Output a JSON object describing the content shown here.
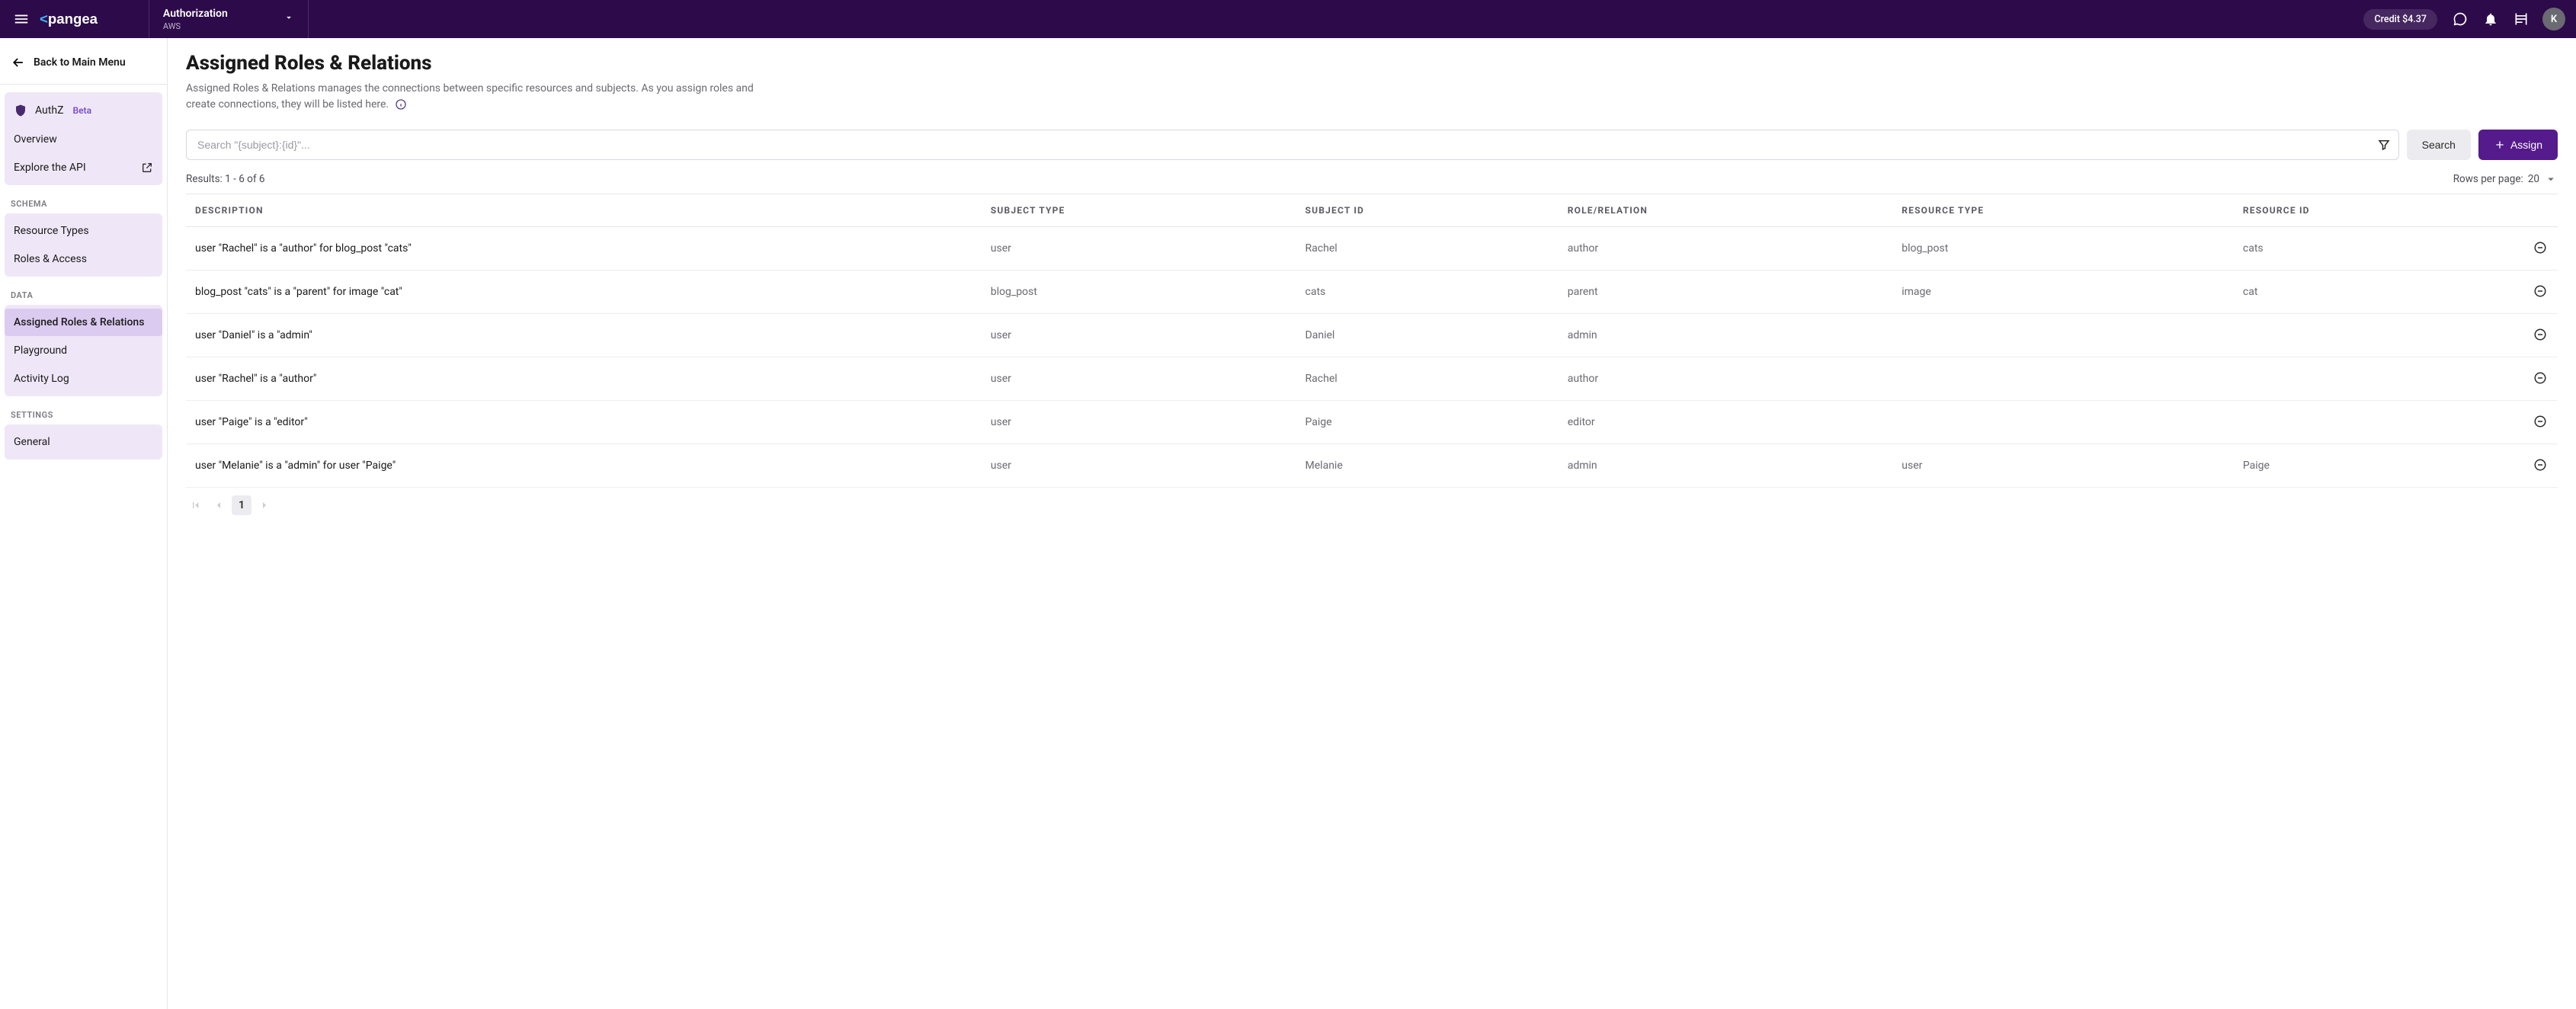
{
  "header": {
    "project_title": "Authorization",
    "project_sub": "AWS",
    "credit_label": "Credit $4.37",
    "avatar_initial": "K"
  },
  "sidebar": {
    "back_label": "Back to Main Menu",
    "product_name": "AuthZ",
    "product_badge": "Beta",
    "nav_overview": "Overview",
    "nav_explore": "Explore the API",
    "heading_schema": "SCHEMA",
    "nav_resource_types": "Resource Types",
    "nav_roles_access": "Roles & Access",
    "heading_data": "DATA",
    "nav_assigned": "Assigned Roles & Relations",
    "nav_playground": "Playground",
    "nav_activity": "Activity Log",
    "heading_settings": "SETTINGS",
    "nav_general": "General"
  },
  "page": {
    "title": "Assigned Roles & Relations",
    "description": "Assigned Roles & Relations manages the connections between specific resources and subjects. As you assign roles and create connections, they will be listed here.",
    "search_placeholder": "Search \"{subject}:{id}\"...",
    "search_button": "Search",
    "assign_button": "Assign",
    "results_text": "Results: 1 - 6 of 6",
    "rows_label": "Rows per page:",
    "rows_value": "20"
  },
  "columns": {
    "description": "Description",
    "subject_type": "Subject Type",
    "subject_id": "Subject ID",
    "role": "Role/Relation",
    "resource_type": "Resource Type",
    "resource_id": "Resource ID"
  },
  "rows": [
    {
      "description": "user \"Rachel\" is a \"author\" for blog_post \"cats\"",
      "subject_type": "user",
      "subject_id": "Rachel",
      "role": "author",
      "resource_type": "blog_post",
      "resource_id": "cats"
    },
    {
      "description": "blog_post \"cats\" is a \"parent\" for image \"cat\"",
      "subject_type": "blog_post",
      "subject_id": "cats",
      "role": "parent",
      "resource_type": "image",
      "resource_id": "cat"
    },
    {
      "description": "user \"Daniel\" is a \"admin\"",
      "subject_type": "user",
      "subject_id": "Daniel",
      "role": "admin",
      "resource_type": "",
      "resource_id": ""
    },
    {
      "description": "user \"Rachel\" is a \"author\"",
      "subject_type": "user",
      "subject_id": "Rachel",
      "role": "author",
      "resource_type": "",
      "resource_id": ""
    },
    {
      "description": "user \"Paige\" is a \"editor\"",
      "subject_type": "user",
      "subject_id": "Paige",
      "role": "editor",
      "resource_type": "",
      "resource_id": ""
    },
    {
      "description": "user \"Melanie\" is a \"admin\" for user \"Paige\"",
      "subject_type": "user",
      "subject_id": "Melanie",
      "role": "admin",
      "resource_type": "user",
      "resource_id": "Paige"
    }
  ],
  "pager": {
    "current": "1"
  }
}
